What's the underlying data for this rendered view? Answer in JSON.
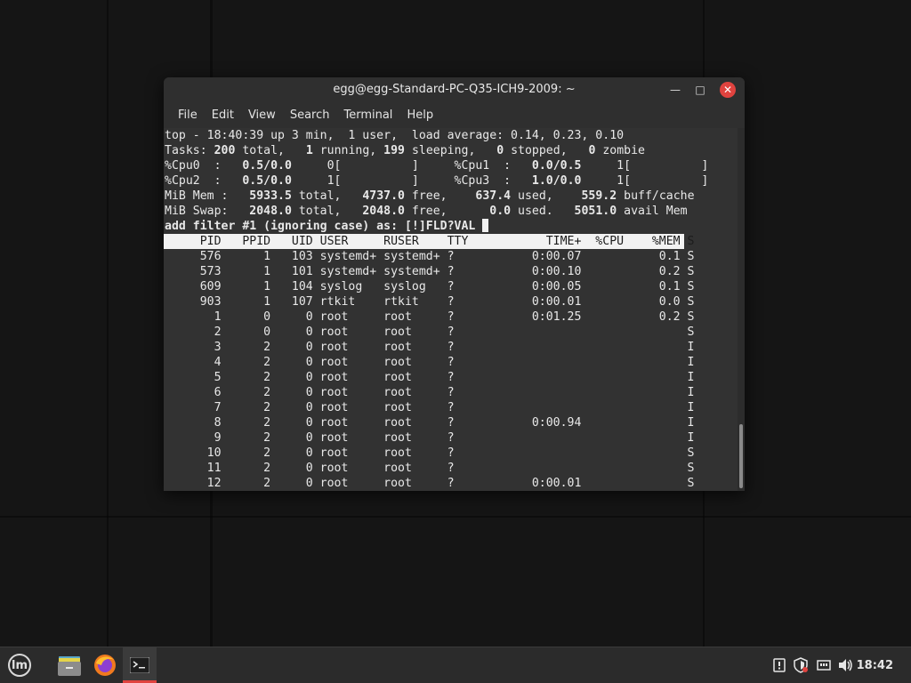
{
  "window": {
    "title": "egg@egg-Standard-PC-Q35-ICH9-2009: ~",
    "minimize_glyph": "—",
    "maximize_glyph": "□",
    "close_glyph": "✕"
  },
  "menu": [
    "File",
    "Edit",
    "View",
    "Search",
    "Terminal",
    "Help"
  ],
  "terminal": {
    "summary": [
      "top - 18:40:39 up 3 min,  1 user,  load average: 0.14, 0.23, 0.10",
      "Tasks: 200 total,   1 running, 199 sleeping,   0 stopped,   0 zombie",
      "%Cpu0  :   0.5/0.0     0[          ]     %Cpu1  :   0.0/0.5     1[          ]",
      "%Cpu2  :   0.5/0.0     1[          ]     %Cpu3  :   1.0/0.0     1[          ]",
      "MiB Mem :   5933.5 total,   4737.0 free,    637.4 used,    559.2 buff/cache",
      "MiB Swap:   2048.0 total,   2048.0 free,      0.0 used.   5051.0 avail Mem"
    ],
    "prompt": "add filter #1 (ignoring case) as: [!]FLD?VAL ",
    "columns": [
      "PID",
      "PPID",
      "UID",
      "USER",
      "RUSER",
      "TTY",
      "TIME+",
      "%CPU",
      "%MEM",
      "S"
    ],
    "rows": [
      [
        "576",
        "1",
        "103",
        "systemd+",
        "systemd+",
        "?",
        "0:00.07",
        "",
        "0.1",
        "S"
      ],
      [
        "573",
        "1",
        "101",
        "systemd+",
        "systemd+",
        "?",
        "0:00.10",
        "",
        "0.2",
        "S"
      ],
      [
        "609",
        "1",
        "104",
        "syslog",
        "syslog",
        "?",
        "0:00.05",
        "",
        "0.1",
        "S"
      ],
      [
        "903",
        "1",
        "107",
        "rtkit",
        "rtkit",
        "?",
        "0:00.01",
        "",
        "0.0",
        "S"
      ],
      [
        "1",
        "0",
        "0",
        "root",
        "root",
        "?",
        "0:01.25",
        "",
        "0.2",
        "S"
      ],
      [
        "2",
        "0",
        "0",
        "root",
        "root",
        "?",
        "",
        "",
        "",
        "S"
      ],
      [
        "3",
        "2",
        "0",
        "root",
        "root",
        "?",
        "",
        "",
        "",
        "I"
      ],
      [
        "4",
        "2",
        "0",
        "root",
        "root",
        "?",
        "",
        "",
        "",
        "I"
      ],
      [
        "5",
        "2",
        "0",
        "root",
        "root",
        "?",
        "",
        "",
        "",
        "I"
      ],
      [
        "6",
        "2",
        "0",
        "root",
        "root",
        "?",
        "",
        "",
        "",
        "I"
      ],
      [
        "7",
        "2",
        "0",
        "root",
        "root",
        "?",
        "",
        "",
        "",
        "I"
      ],
      [
        "8",
        "2",
        "0",
        "root",
        "root",
        "?",
        "0:00.94",
        "",
        "",
        "I"
      ],
      [
        "9",
        "2",
        "0",
        "root",
        "root",
        "?",
        "",
        "",
        "",
        "I"
      ],
      [
        "10",
        "2",
        "0",
        "root",
        "root",
        "?",
        "",
        "",
        "",
        "S"
      ],
      [
        "11",
        "2",
        "0",
        "root",
        "root",
        "?",
        "",
        "",
        "",
        "S"
      ],
      [
        "12",
        "2",
        "0",
        "root",
        "root",
        "?",
        "0:00.01",
        "",
        "",
        "S"
      ]
    ]
  },
  "taskbar": {
    "apps": [
      {
        "name": "menu",
        "icon": "linux-mint-logo-icon"
      },
      {
        "name": "files",
        "icon": "folder-icon"
      },
      {
        "name": "firefox",
        "icon": "firefox-icon"
      },
      {
        "name": "terminal",
        "icon": "terminal-icon",
        "active": true
      }
    ],
    "tray_icons": [
      "notifications-icon",
      "update-shield-icon",
      "network-icon",
      "volume-icon"
    ],
    "clock": "18:42"
  },
  "colors": {
    "accent": "#e0433f",
    "terminal_bg": "#323232",
    "header_bg": "#f2f2f2"
  }
}
